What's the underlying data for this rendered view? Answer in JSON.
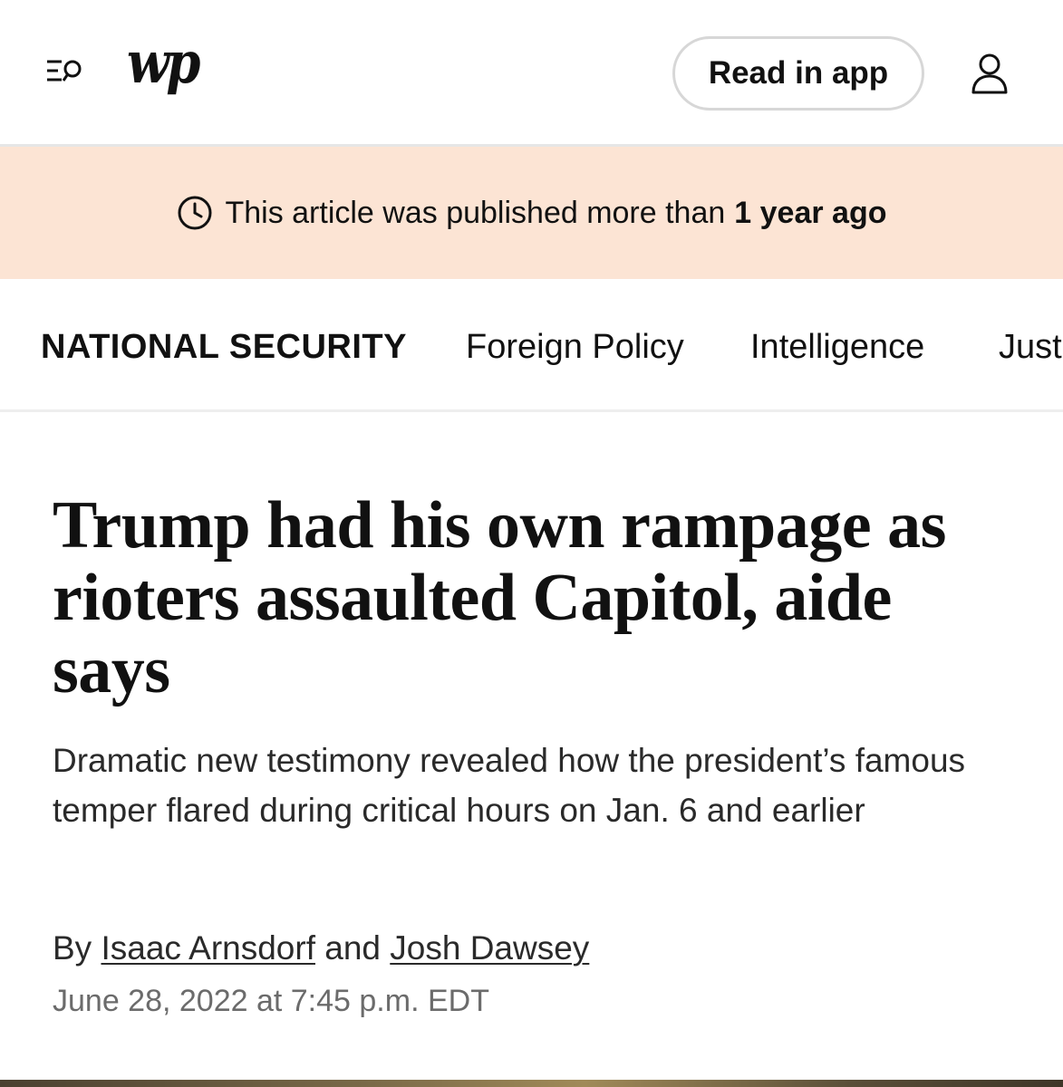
{
  "header": {
    "logo_text": "wp",
    "menu_icon": "menu-search-icon",
    "read_in_app_label": "Read in app",
    "account_icon": "user-icon"
  },
  "age_notice": {
    "icon": "clock-icon",
    "prefix": "This article was published more than",
    "emphasis": "1 year ago",
    "background_color": "#fce4d4"
  },
  "section_nav": {
    "section_title": "NATIONAL SECURITY",
    "items": [
      {
        "label": "Foreign Policy"
      },
      {
        "label": "Intelligence"
      },
      {
        "label": "Just"
      }
    ]
  },
  "article": {
    "headline": "Trump had his own rampage as rioters assaulted Capitol, aide says",
    "subheadline": "Dramatic new testimony revealed how the president’s famous temper flared during critical hours on Jan. 6 and earlier",
    "byline": {
      "prefix": "By",
      "author_1": "Isaac Arnsdorf",
      "conjunction": "and",
      "author_2": "Josh Dawsey"
    },
    "timestamp": "June 28, 2022 at 7:45 p.m. EDT"
  }
}
